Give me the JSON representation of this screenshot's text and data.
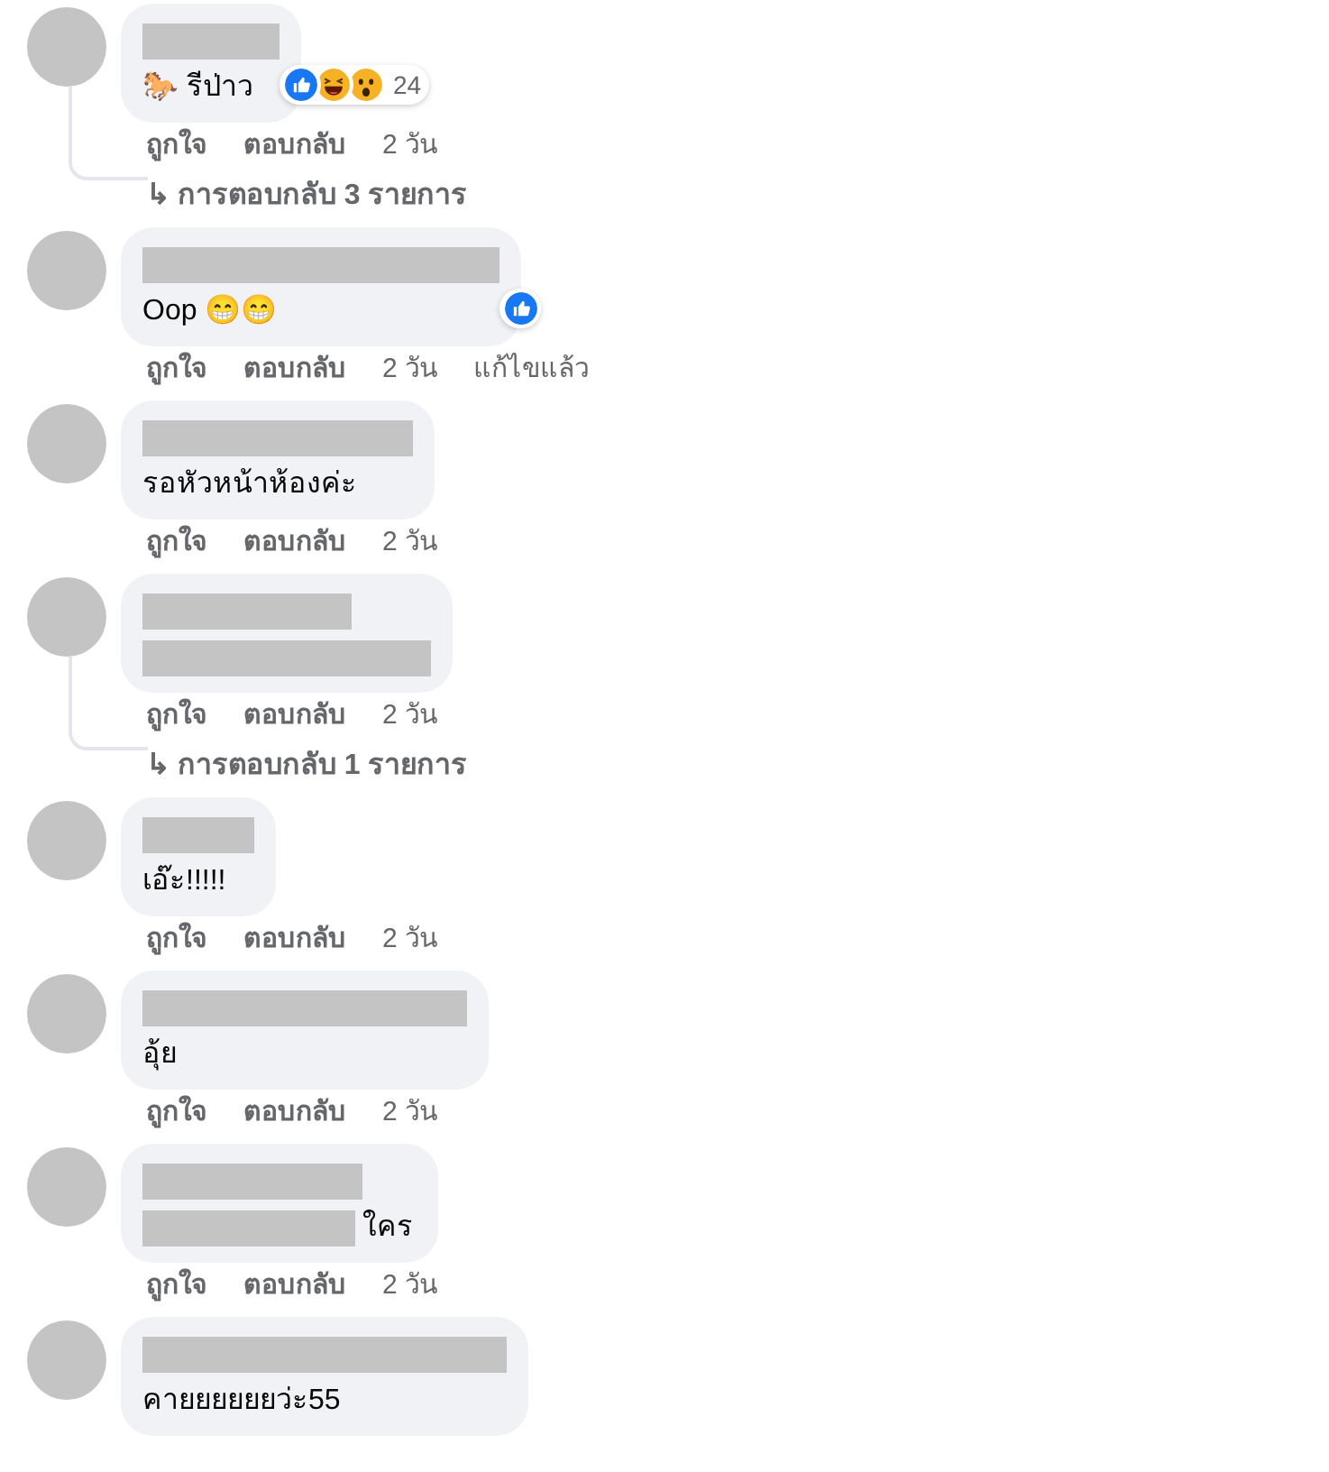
{
  "comments": [
    {
      "name_redacted": true,
      "text": "🐎 รีป่าว",
      "reactions": [
        {
          "kind": "like"
        },
        {
          "kind": "haha"
        },
        {
          "kind": "wow"
        }
      ],
      "reaction_count": "24",
      "actions": [
        "ถูกใจ",
        "ตอบกลับ"
      ],
      "time": "2 วัน",
      "replies_link": {
        "arrow": "↳",
        "label": "การตอบกลับ 3 รายการ"
      }
    },
    {
      "name_redacted": true,
      "text": "Oop 😁😁",
      "reactions": [
        {
          "kind": "like"
        }
      ],
      "actions": [
        "ถูกใจ",
        "ตอบกลับ"
      ],
      "time": "2 วัน",
      "edited": "แก้ไขแล้ว"
    },
    {
      "name_redacted": true,
      "text": "รอหัวหน้าห้องค่ะ",
      "actions": [
        "ถูกใจ",
        "ตอบกลับ"
      ],
      "time": "2 วัน"
    },
    {
      "name_redacted": true,
      "text_redacted": true,
      "actions": [
        "ถูกใจ",
        "ตอบกลับ"
      ],
      "time": "2 วัน",
      "replies_link": {
        "arrow": "↳",
        "label": "การตอบกลับ 1 รายการ"
      }
    },
    {
      "name_redacted": true,
      "text": "เอ๊ะ!!!!!",
      "actions": [
        "ถูกใจ",
        "ตอบกลับ"
      ],
      "time": "2 วัน"
    },
    {
      "name_redacted": true,
      "text": "อุ้ย",
      "actions": [
        "ถูกใจ",
        "ตอบกลับ"
      ],
      "time": "2 วัน"
    },
    {
      "name_redacted": true,
      "text_redacted": true,
      "text": "ใคร",
      "actions": [
        "ถูกใจ",
        "ตอบกลับ"
      ],
      "time": "2 วัน"
    },
    {
      "name_redacted": true,
      "text": "คายยยยยยว่ะ55"
    }
  ]
}
